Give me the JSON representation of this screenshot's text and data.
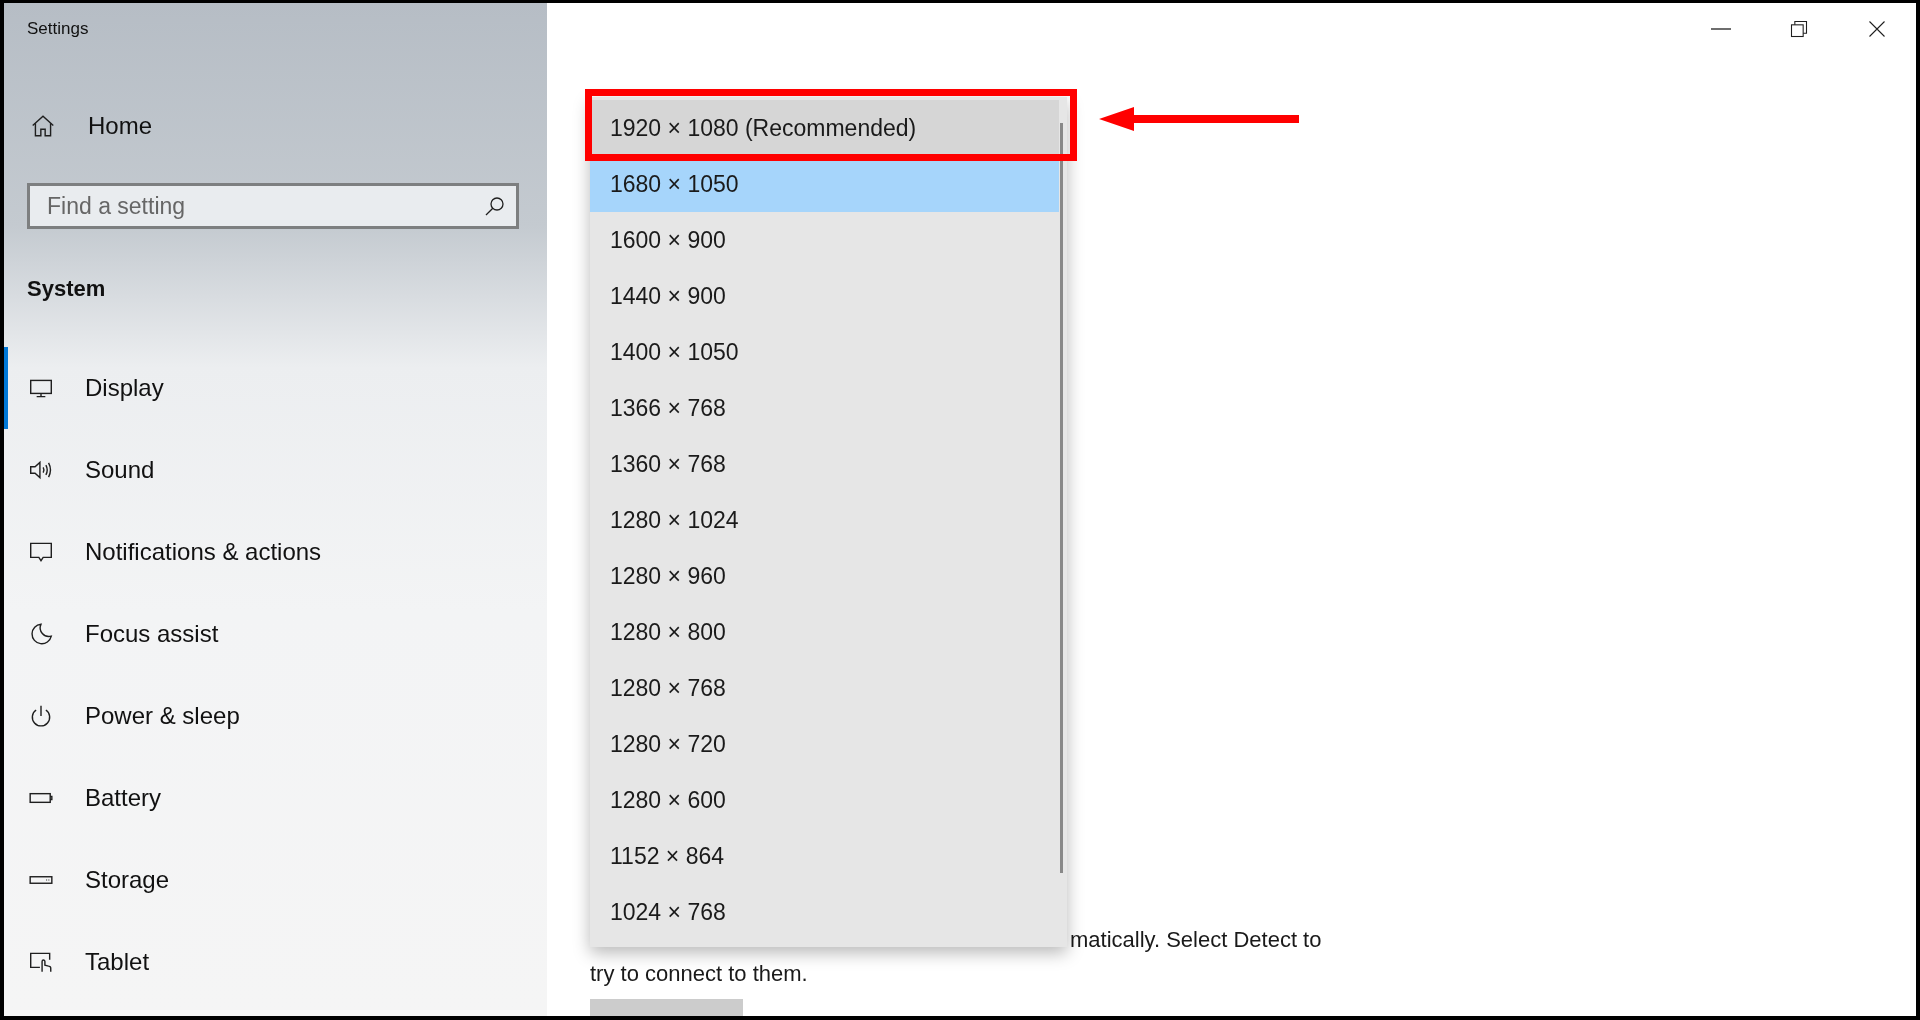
{
  "window": {
    "title": "Settings"
  },
  "sidebar": {
    "home": "Home",
    "search": {
      "placeholder": "Find a setting"
    },
    "section": "System",
    "items": [
      {
        "label": "Display",
        "selected": true
      },
      {
        "label": "Sound",
        "selected": false
      },
      {
        "label": "Notifications & actions",
        "selected": false
      },
      {
        "label": "Focus assist",
        "selected": false
      },
      {
        "label": "Power & sleep",
        "selected": false
      },
      {
        "label": "Battery",
        "selected": false
      },
      {
        "label": "Storage",
        "selected": false
      },
      {
        "label": "Tablet",
        "selected": false
      }
    ]
  },
  "resolution_dropdown": {
    "options": [
      {
        "label": "1920 × 1080 (Recommended)",
        "selected": false,
        "hovered": true
      },
      {
        "label": "1680 × 1050",
        "selected": true,
        "hovered": false
      },
      {
        "label": "1600 × 900",
        "selected": false,
        "hovered": false
      },
      {
        "label": "1440 × 900",
        "selected": false,
        "hovered": false
      },
      {
        "label": "1400 × 1050",
        "selected": false,
        "hovered": false
      },
      {
        "label": "1366 × 768",
        "selected": false,
        "hovered": false
      },
      {
        "label": "1360 × 768",
        "selected": false,
        "hovered": false
      },
      {
        "label": "1280 × 1024",
        "selected": false,
        "hovered": false
      },
      {
        "label": "1280 × 960",
        "selected": false,
        "hovered": false
      },
      {
        "label": "1280 × 800",
        "selected": false,
        "hovered": false
      },
      {
        "label": "1280 × 768",
        "selected": false,
        "hovered": false
      },
      {
        "label": "1280 × 720",
        "selected": false,
        "hovered": false
      },
      {
        "label": "1280 × 600",
        "selected": false,
        "hovered": false
      },
      {
        "label": "1152 × 864",
        "selected": false,
        "hovered": false
      },
      {
        "label": "1024 × 768",
        "selected": false,
        "hovered": false
      }
    ]
  },
  "main": {
    "text_lines": [
      "matically. Select Detect to",
      "try to connect to them."
    ]
  }
}
